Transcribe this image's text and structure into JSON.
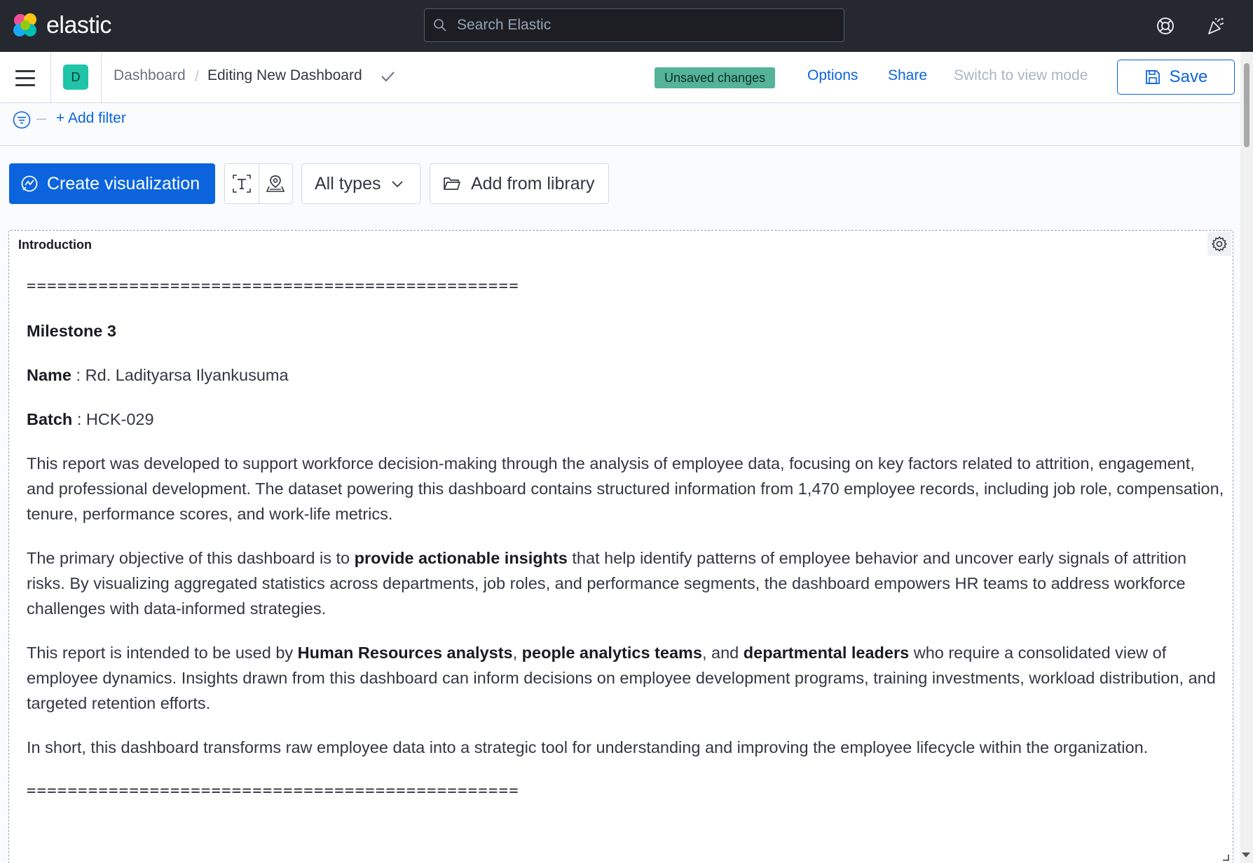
{
  "header": {
    "brand": "elastic",
    "search_placeholder": "Search Elastic",
    "help_icon": "help-icon",
    "news_icon": "newsfeed-icon"
  },
  "subheader": {
    "space_initial": "D",
    "breadcrumb_root": "Dashboard",
    "breadcrumb_separator": "/",
    "breadcrumb_current": "Editing New Dashboard",
    "unsaved_badge": "Unsaved changes",
    "options_label": "Options",
    "share_label": "Share",
    "view_mode_label": "Switch to view mode",
    "save_label": "Save"
  },
  "filterbar": {
    "add_filter_label": "+ Add filter"
  },
  "toolbar": {
    "create_label": "Create visualization",
    "types_label": "All types",
    "library_label": "Add from library"
  },
  "panel": {
    "title": "Introduction",
    "rule_top": "================================================",
    "heading": "Milestone 3",
    "name_label": "Name",
    "name_value": " : Rd. Ladityarsa Ilyankusuma",
    "batch_label": "Batch",
    "batch_value": " : HCK-029",
    "para1": "This report was developed to support workforce decision-making through the analysis of employee data, focusing on key factors related to attrition, engagement, and professional development. The dataset powering this dashboard contains structured information from 1,470 employee records, including job role, compensation, tenure, performance scores, and work-life metrics.",
    "para2_a": "The primary objective of this dashboard is to ",
    "para2_b": "provide actionable insights",
    "para2_c": " that help identify patterns of employee behavior and uncover early signals of attrition risks. By visualizing aggregated statistics across departments, job roles, and performance segments, the dashboard empowers HR teams to address workforce challenges with data-informed strategies.",
    "para3_a": "This report is intended to be used by ",
    "para3_b": "Human Resources analysts",
    "para3_c": ", ",
    "para3_d": "people analytics teams",
    "para3_e": ", and ",
    "para3_f": "departmental leaders",
    "para3_g": " who require a consolidated view of employee dynamics. Insights drawn from this dashboard can inform decisions on employee development programs, training investments, workload distribution, and targeted retention efforts.",
    "para4": "In short, this dashboard transforms raw employee data into a strategic tool for understanding and improving the employee lifecycle within the organization.",
    "rule_bottom": "================================================"
  },
  "colors": {
    "header_bg": "#25282f",
    "primary": "#0b64dd",
    "unsaved_badge": "#54b399",
    "space_badge": "#20c4a8"
  }
}
